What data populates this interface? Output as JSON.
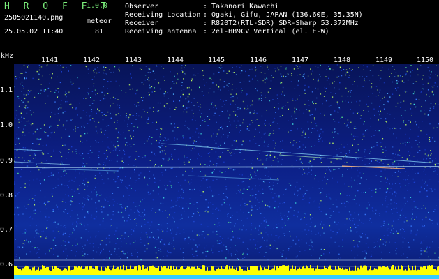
{
  "header": {
    "app_title": "H R O F F T",
    "app_version": "1.0.0",
    "file_name": "2505021140.png",
    "type_label": "meteor",
    "datetime": "25.05.02 11:40",
    "count_value": "81",
    "info": [
      {
        "label": "Observer",
        "value": ": Takanori Kawachi"
      },
      {
        "label": "Receiving Location",
        "value": ": Ogaki, Gifu, JAPAN (136.60E, 35.35N)"
      },
      {
        "label": "Receiver",
        "value": ": R820T2(RTL-SDR) SDR-Sharp 53.372MHz"
      },
      {
        "label": "Receiving antenna",
        "value": ": 2el-HB9CV Vertical (el. E-W)"
      }
    ]
  },
  "axes": {
    "y_unit": "kHz",
    "x_ticks": [
      "1141",
      "1142",
      "1143",
      "1144",
      "1145",
      "1146",
      "1147",
      "1148",
      "1149",
      "1150"
    ],
    "y_ticks": [
      "1.1",
      "1.0",
      "0.9",
      "0.8",
      "0.7",
      "0.6"
    ]
  },
  "colors": {
    "background": "#000000",
    "header_text_green": "#7cf07c",
    "header_text_white": "#ffffff",
    "spectrum_low": "#0a1a70",
    "spectrum_high": "#ffff00",
    "noise_band": "#33ccff"
  }
}
